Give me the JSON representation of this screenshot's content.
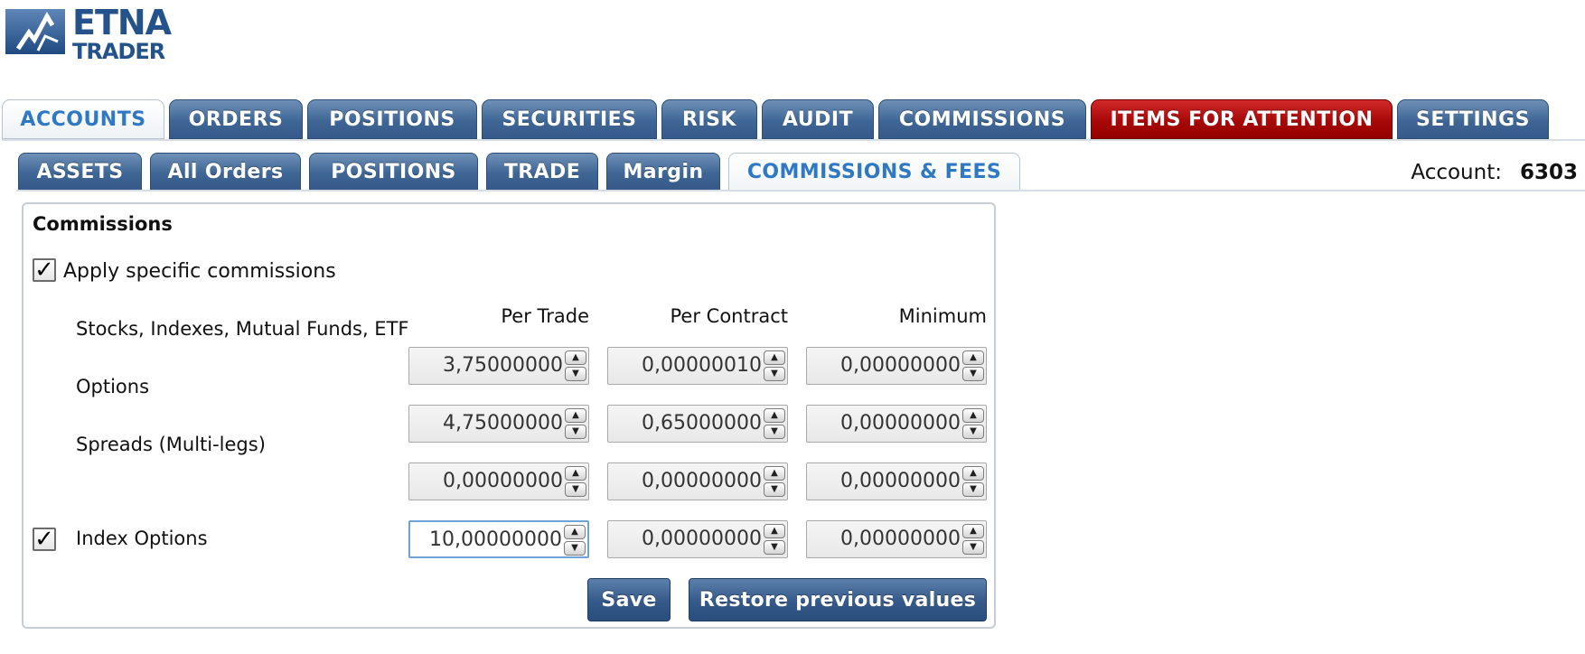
{
  "logo": {
    "line1": "ETNA",
    "line2": "TRADER",
    "icon": "etna-logo-mark"
  },
  "main_tabs": [
    {
      "label": "ACCOUNTS",
      "state": "active"
    },
    {
      "label": "ORDERS"
    },
    {
      "label": "POSITIONS"
    },
    {
      "label": "SECURITIES"
    },
    {
      "label": "RISK"
    },
    {
      "label": "AUDIT"
    },
    {
      "label": "COMMISSIONS"
    },
    {
      "label": "ITEMS FOR ATTENTION",
      "state": "alert"
    },
    {
      "label": "SETTINGS"
    }
  ],
  "sub_tabs": [
    {
      "label": "ASSETS"
    },
    {
      "label": "All Orders"
    },
    {
      "label": "POSITIONS"
    },
    {
      "label": "TRADE"
    },
    {
      "label": "Margin"
    },
    {
      "label": "COMMISSIONS & FEES",
      "state": "active"
    }
  ],
  "account": {
    "label": "Account:",
    "value": "6303"
  },
  "commissions": {
    "title": "Commissions",
    "apply_specific": {
      "checked": true,
      "mark": "✓",
      "label": "Apply specific commissions"
    },
    "columns": [
      "Per Trade",
      "Per Contract",
      "Minimum"
    ],
    "rows": [
      {
        "label": "Stocks, Indexes, Mutual Funds, ETF",
        "checkbox": false,
        "values": [
          "3,75000000",
          "0,00000010",
          "0,00000000"
        ]
      },
      {
        "label": "Options",
        "checkbox": false,
        "values": [
          "4,75000000",
          "0,65000000",
          "0,00000000"
        ]
      },
      {
        "label": "Spreads (Multi-legs)",
        "checkbox": false,
        "values": [
          "0,00000000",
          "0,00000000",
          "0,00000000"
        ]
      },
      {
        "label": "Index Options",
        "checkbox": true,
        "checked": true,
        "mark": "✓",
        "values": [
          "10,00000000",
          "0,00000000",
          "0,00000000"
        ]
      }
    ],
    "spinner_up": "▲",
    "spinner_down": "▼",
    "save_label": "Save",
    "restore_label": "Restore previous values"
  },
  "colors": {
    "tab_blue": "#3e6695",
    "active_text": "#2f79c4",
    "alert_red": "#a80808"
  }
}
